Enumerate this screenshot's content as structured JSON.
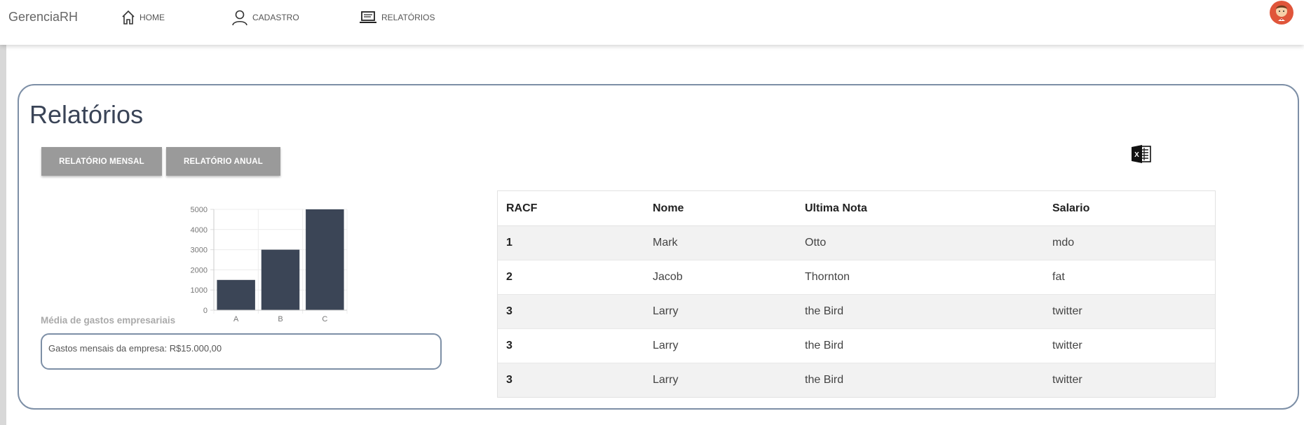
{
  "app": {
    "brand": "GerenciaRH"
  },
  "nav": {
    "items": [
      {
        "label": "HOME",
        "icon": "home-icon"
      },
      {
        "label": "CADASTRO",
        "icon": "user-icon"
      },
      {
        "label": "RELATÓRIOS",
        "icon": "laptop-icon"
      }
    ]
  },
  "page": {
    "title": "Relatórios"
  },
  "buttons": {
    "monthly": "RELATÓRIO MENSAL",
    "annual": "RELATÓRIO ANUAL"
  },
  "export": {
    "icon": "excel-icon"
  },
  "chart_data": {
    "type": "bar",
    "categories": [
      "A",
      "B",
      "C"
    ],
    "values": [
      1500,
      3000,
      5000
    ],
    "yticks": [
      0,
      1000,
      2000,
      3000,
      4000,
      5000
    ],
    "ylim": [
      0,
      5000
    ],
    "bar_color": "#3b4556",
    "grid": true
  },
  "summary": {
    "caption": "Média de gastos empresariais",
    "text": "Gastos mensais da empresa: R$15.000,00"
  },
  "table": {
    "headers": [
      "RACF",
      "Nome",
      "Ultima Nota",
      "Salario"
    ],
    "rows": [
      [
        "1",
        "Mark",
        "Otto",
        "mdo"
      ],
      [
        "2",
        "Jacob",
        "Thornton",
        "fat"
      ],
      [
        "3",
        "Larry",
        "the Bird",
        "twitter"
      ],
      [
        "3",
        "Larry",
        "the Bird",
        "twitter"
      ],
      [
        "3",
        "Larry",
        "the Bird",
        "twitter"
      ]
    ]
  },
  "colors": {
    "accent_border": "#7d8fa6",
    "button_bg": "#9a9a9a",
    "title": "#3a4457"
  }
}
